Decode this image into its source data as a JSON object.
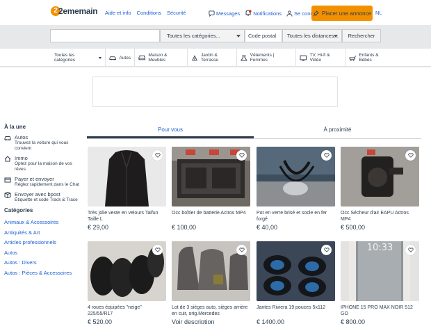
{
  "header": {
    "logo_text": "2ememain",
    "logo_badge": "2",
    "links": [
      "Aide et info",
      "Conditions",
      "Sécurité"
    ],
    "messages_label": "Messages",
    "notifications_label": "Notifications",
    "login_label": "Se connecter",
    "place_ad_label": "Placer une annonce",
    "language_label": "NL",
    "accent_color": "#f29100",
    "link_color": "#1b5ed2"
  },
  "search": {
    "query_placeholder": "",
    "category_label": "Toutes les catégories...",
    "postal_placeholder": "Code postal",
    "distance_label": "Toutes les distances...",
    "submit_label": "Rechercher"
  },
  "categories_bar": [
    {
      "label": "Toutes les catégories",
      "icon": "chevron-down-icon"
    },
    {
      "label": "Autos",
      "icon": "car-icon"
    },
    {
      "label": "Maison & Meubles",
      "icon": "sofa-icon"
    },
    {
      "label": "Jardin & Terrasse",
      "icon": "garden-icon"
    },
    {
      "label": "Vêtements | Femmes",
      "icon": "dress-icon"
    },
    {
      "label": "TV, Hi-fi & Vidéo",
      "icon": "tv-icon"
    },
    {
      "label": "Enfants & Bébés",
      "icon": "baby-icon"
    }
  ],
  "sidebar": {
    "featured_heading": "À la une",
    "featured": [
      {
        "title": "Autos",
        "desc": "Trouvez la voiture qui vous convient",
        "icon": "car-icon"
      },
      {
        "title": "Immo",
        "desc": "Optez pour la maison de vos rêves",
        "icon": "house-icon"
      },
      {
        "title": "Payer et envoyer",
        "desc": "Réglez rapidement dans le Chat",
        "icon": "payment-icon"
      },
      {
        "title": "Envoyer avec bpost",
        "desc": "Étiquette et code Track & Trace",
        "icon": "package-icon"
      }
    ],
    "categories_heading": "Catégories",
    "categories": [
      "Animaux & Accessoires",
      "Antiquités & Art",
      "Articles professionnels",
      "Autos",
      "Autos : Divers",
      "Autos : Pièces & Accessoires"
    ]
  },
  "tabs": [
    "Pour vous",
    "À proximité"
  ],
  "active_tab": "Pour vous",
  "listings": [
    {
      "title": "Très jolie veste en velours Taifun Taille L",
      "price": "€ 29,00",
      "image": "jacket"
    },
    {
      "title": "Occ boîtier de batterie Actros MP4",
      "price": "€ 100,00",
      "image": "battery"
    },
    {
      "title": "Pot en verre brisé et socle en fer forgé",
      "price": "€ 40,00",
      "image": "pot"
    },
    {
      "title": "Occ Sécheur d'air EAPU Actros MP4",
      "price": "€ 500,00",
      "image": "dryer"
    },
    {
      "title": "4 roues équipées \"neige\" 225/55/R17",
      "price": "€ 520,00",
      "image": "wheels"
    },
    {
      "title": "Lot de 3 sièges auto, sièges arrière en cuir, orig.Mercedes",
      "price": "Voir description",
      "image": "seats"
    },
    {
      "title": "Jantes Riviera 19 pouces 5x112",
      "price": "€ 1400,00",
      "image": "rims"
    },
    {
      "title": "IPHONE 15 PRO MAX NOIR 512 GO",
      "price": "€ 800,00",
      "image": "iphone"
    }
  ],
  "iphone_clock": "10:33"
}
